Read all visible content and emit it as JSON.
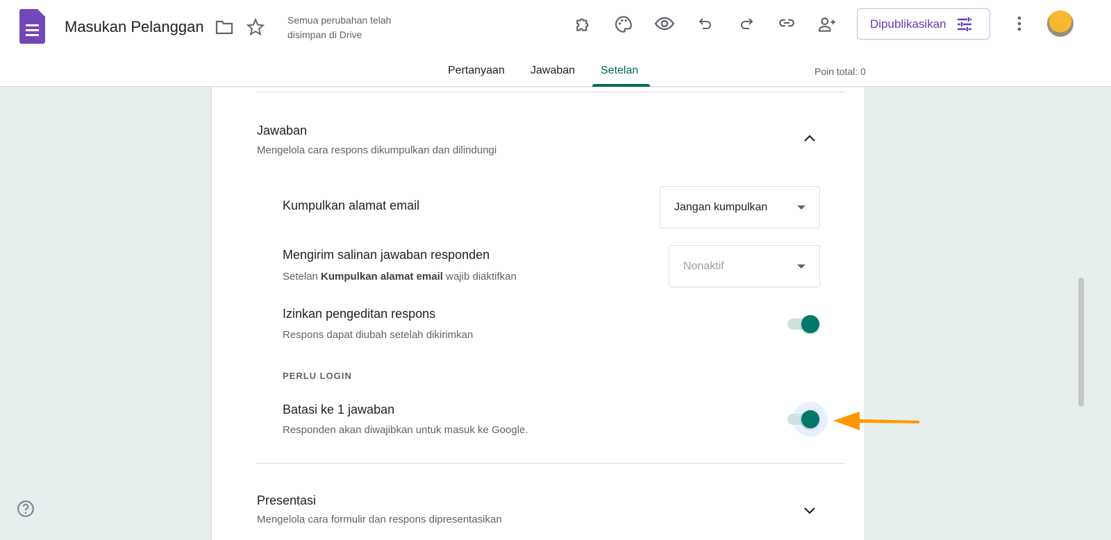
{
  "header": {
    "title": "Masukan Pelanggan",
    "save_status": "Semua perubahan telah disimpan di Drive",
    "publish_label": "Dipublikasikan",
    "icons": [
      "addon-icon",
      "palette-icon",
      "preview-icon",
      "undo-icon",
      "redo-icon",
      "link-icon",
      "add-collaborator-icon",
      "more-icon"
    ]
  },
  "tabs": [
    {
      "label": "Pertanyaan"
    },
    {
      "label": "Jawaban"
    },
    {
      "label": "Setelan",
      "active": true
    }
  ],
  "points": "Poin total: 0",
  "responses": {
    "title": "Jawaban",
    "subtitle": "Mengelola cara respons dikumpulkan dan dilindungi",
    "collect_email": {
      "label": "Kumpulkan alamat email",
      "value": "Jangan kumpulkan"
    },
    "send_copy": {
      "label": "Mengirim salinan jawaban responden",
      "hint_pre": "Setelan ",
      "hint_bold": "Kumpulkan alamat email",
      "hint_post": " wajib diaktifkan",
      "value": "Nonaktif"
    },
    "allow_edit": {
      "label": "Izinkan pengeditan respons",
      "hint": "Respons dapat diubah setelah dikirimkan",
      "on": true
    },
    "login_section": "PERLU LOGIN",
    "limit_one": {
      "label": "Batasi ke 1 jawaban",
      "hint": "Responden akan diwajibkan untuk masuk ke Google.",
      "on": true
    }
  },
  "presentation": {
    "title": "Presentasi",
    "subtitle": "Mengelola cara formulir dan respons dipresentasikan"
  },
  "colors": {
    "accent": "#00796b",
    "publish": "#673ab7",
    "arrow": "#ff9800"
  }
}
